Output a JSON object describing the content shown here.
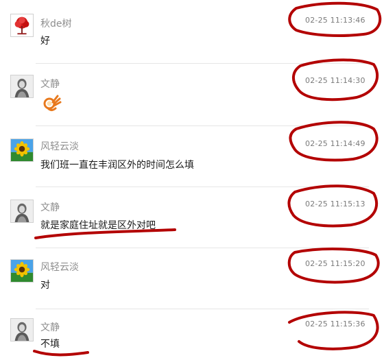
{
  "messages": [
    {
      "sender": "秋de树",
      "text": "好",
      "time": "02-25 11:13:46",
      "avatar": "red-tree-avatar"
    },
    {
      "sender": "文静",
      "text": "",
      "time": "02-25 11:14:30",
      "avatar": "girl-sketch-avatar",
      "emoji": "ok-hand-emoji"
    },
    {
      "sender": "风轻云淡",
      "text": "我们班一直在丰润区外的时间怎么填",
      "time": "02-25 11:14:49",
      "avatar": "sunflower-avatar"
    },
    {
      "sender": "文静",
      "text": "就是家庭住址就是区外对吧",
      "time": "02-25 11:15:13",
      "avatar": "girl-sketch-avatar"
    },
    {
      "sender": "风轻云淡",
      "text": "对",
      "time": "02-25 11:15:20",
      "avatar": "sunflower-avatar"
    },
    {
      "sender": "文静",
      "text": "不填",
      "time": "02-25 11:15:36",
      "avatar": "girl-sketch-avatar"
    }
  ],
  "annotation_color": "#b30000"
}
